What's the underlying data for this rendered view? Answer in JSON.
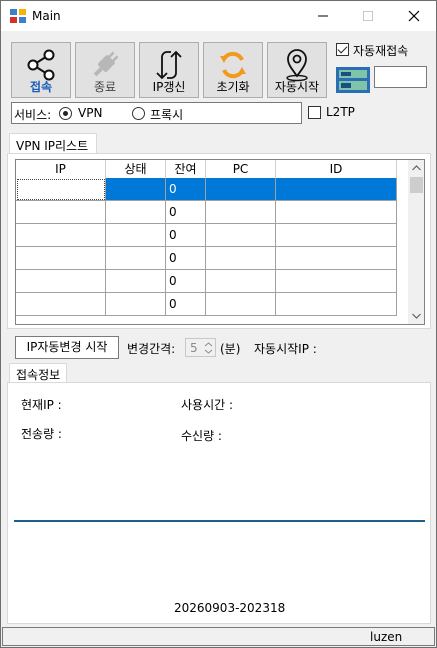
{
  "window": {
    "title": "Main"
  },
  "toolbar": {
    "connect_label": "접속",
    "end_label": "종료",
    "ip_refresh_label": "IP갱신",
    "reset_label": "초기화",
    "auto_start_label": "자동시작",
    "auto_reconnect_label": "자동재접속",
    "auto_reconnect_checked": true,
    "side_field_value": ""
  },
  "service": {
    "label": "서비스:",
    "options": [
      "VPN",
      "프록시"
    ],
    "selected": "VPN",
    "l2tp_label": "L2TP",
    "l2tp_checked": false
  },
  "vpn_tab": {
    "label": "VPN IP리스트",
    "columns": [
      "IP",
      "상태",
      "잔여",
      "PC",
      "ID"
    ],
    "rows": [
      {
        "ip": "",
        "status": "",
        "remaining": "0",
        "pc": "",
        "id": ""
      },
      {
        "ip": "",
        "status": "",
        "remaining": "0",
        "pc": "",
        "id": ""
      },
      {
        "ip": "",
        "status": "",
        "remaining": "0",
        "pc": "",
        "id": ""
      },
      {
        "ip": "",
        "status": "",
        "remaining": "0",
        "pc": "",
        "id": ""
      },
      {
        "ip": "",
        "status": "",
        "remaining": "0",
        "pc": "",
        "id": ""
      },
      {
        "ip": "",
        "status": "",
        "remaining": "0",
        "pc": "",
        "id": ""
      }
    ],
    "selected_row": 0
  },
  "interval": {
    "start_button": "IP자동변경 시작",
    "label": "변경간격:",
    "value": "5",
    "unit": "(분)",
    "auto_start_ip_label": "자동시작IP :"
  },
  "info_tab": {
    "label": "접속정보",
    "current_ip_label": "현재IP :",
    "usage_time_label": "사용시간 :",
    "sent_label": "전송량 :",
    "received_label": "수신량 :",
    "version": "20260903-202318"
  },
  "status_bar": {
    "user": "luzen"
  },
  "colors": {
    "selection": "#0078d7",
    "accent_orange": "#f39a1e",
    "accent_blue": "#1b5cb8",
    "divider": "#1f5f8c"
  }
}
